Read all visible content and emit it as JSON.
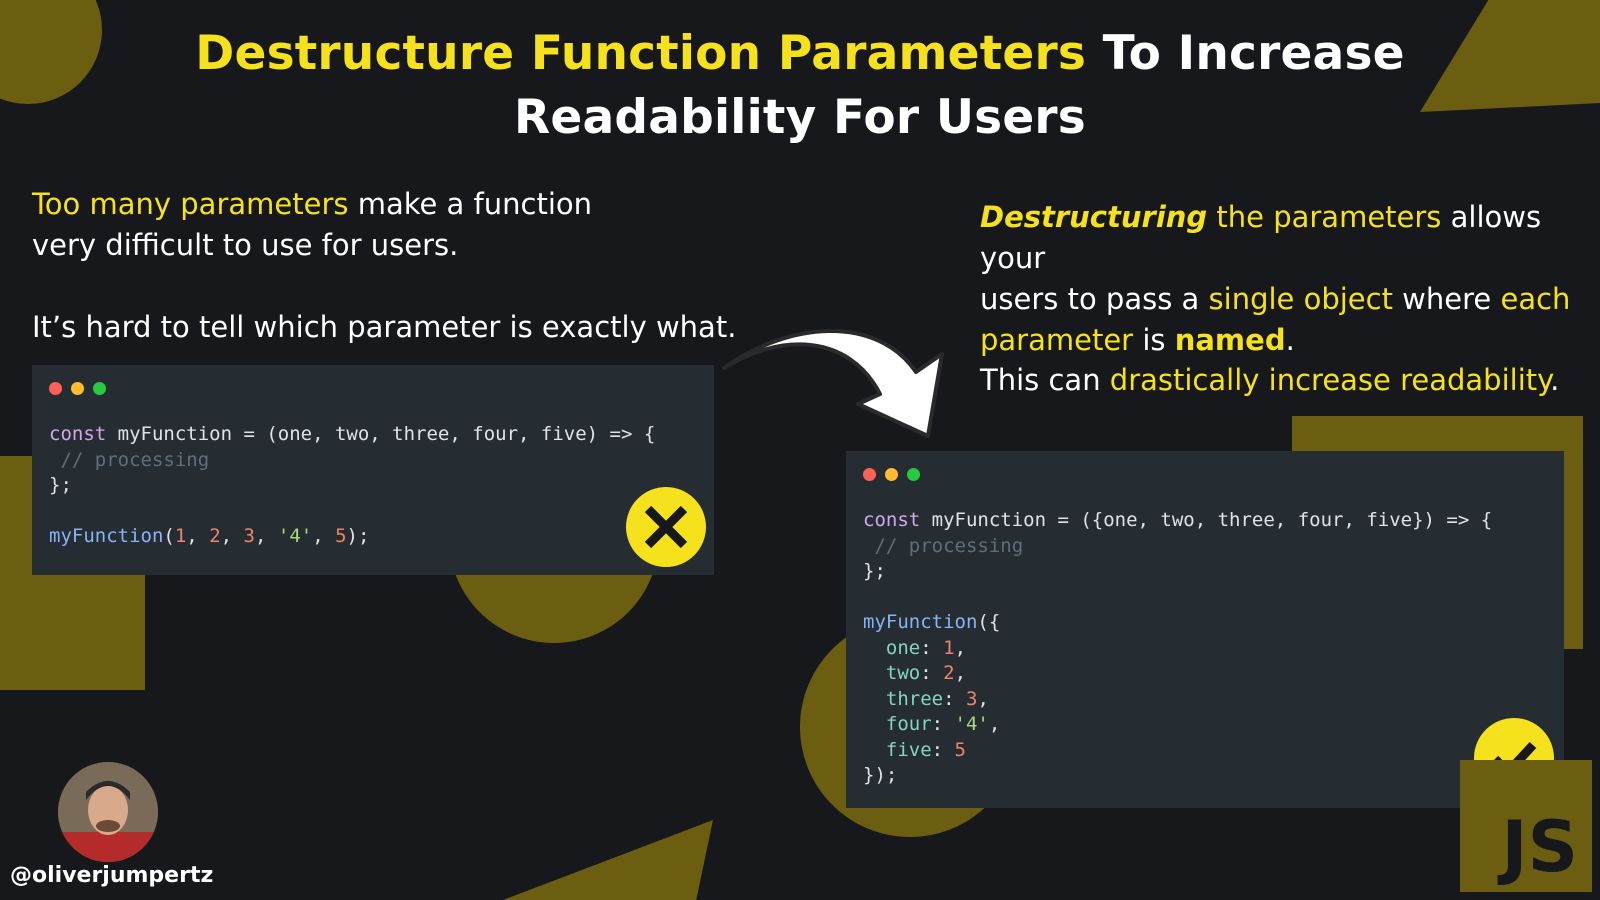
{
  "title": {
    "highlight": "Destructure Function Parameters",
    "rest_line1": " To Increase",
    "line2": "Readability For Users"
  },
  "left": {
    "p1_highlight": "Too many parameters",
    "p1_rest": " make a function",
    "p1_line2": "very difficult to use for users.",
    "p2": "It’s hard to tell which parameter is exactly what.",
    "code": {
      "kw_const": "const",
      "line1_rest": " myFunction = (one, two, three, four, five) => {",
      "comment": " // processing",
      "close": "};",
      "call_fn": "myFunction",
      "call_open": "(",
      "arg1": "1",
      "arg2": "2",
      "arg3": "3",
      "arg4": "'4'",
      "arg5": "5",
      "sep": ", ",
      "call_close": ");"
    },
    "badge_icon": "x-icon"
  },
  "right": {
    "p1_em": "Destructuring",
    "p1_a": " the parameters",
    "p1_b": " allows your",
    "p1_c": "users to pass a ",
    "p1_d": "single object",
    "p1_e": " where ",
    "p1_f": "each",
    "p1_g": "parameter",
    "p1_h": " is ",
    "p1_bold": "named",
    "p1_end": ".",
    "p2_a": "This can ",
    "p2_hl": "drastically increase readability",
    "p2_end": ".",
    "code": {
      "kw_const": "const",
      "line1_rest": " myFunction = ({one, two, three, four, five}) => {",
      "comment": " // processing",
      "close": "};",
      "call_fn": "myFunction",
      "call_open": "({",
      "props": [
        {
          "key": "one",
          "val": "1",
          "comma": ","
        },
        {
          "key": "two",
          "val": "2",
          "comma": ","
        },
        {
          "key": "three",
          "val": "3",
          "comma": ","
        },
        {
          "key": "four",
          "val": "'4'",
          "comma": ","
        },
        {
          "key": "five",
          "val": "5",
          "comma": ""
        }
      ],
      "call_close": "});"
    },
    "badge_icon": "check-icon"
  },
  "author": {
    "handle": "@oliverjumpertz"
  },
  "logo": {
    "text": "JS"
  },
  "colors": {
    "accent": "#f6e21c",
    "background": "#17181c",
    "panel": "#252d33",
    "decor": "#6b5e10",
    "dot_red": "#fe5f57",
    "dot_yellow": "#febc2e",
    "dot_green": "#28c840"
  }
}
